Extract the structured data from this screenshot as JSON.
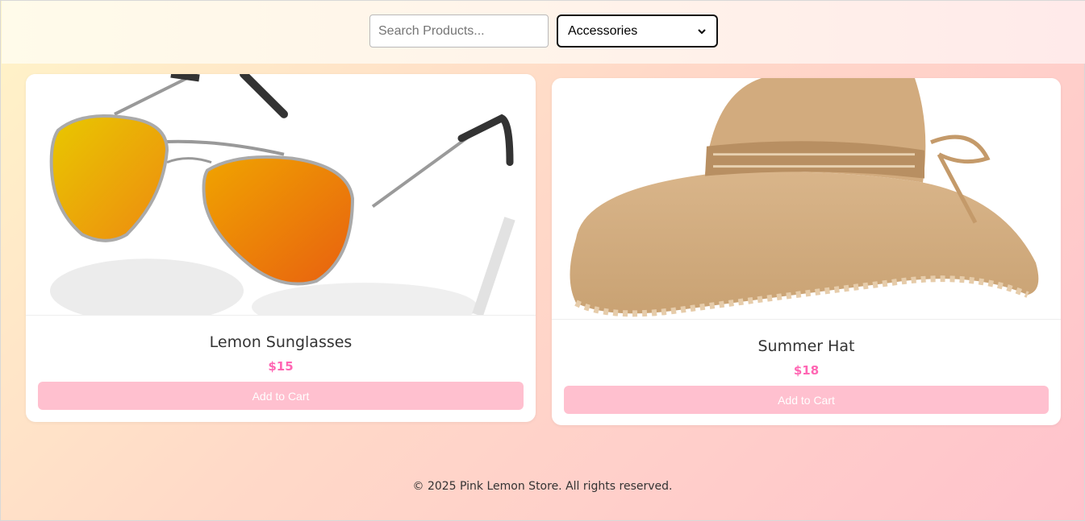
{
  "header": {
    "search_placeholder": "Search Products...",
    "category_selected": "Accessories"
  },
  "products": [
    {
      "name": "Lemon Sunglasses",
      "price": "$15",
      "button": "Add to Cart",
      "image": "sunglasses-image"
    },
    {
      "name": "Summer Hat",
      "price": "$18",
      "button": "Add to Cart",
      "image": "straw-hat-image"
    }
  ],
  "footer": {
    "text": "© 2025 Pink Lemon Store. All rights reserved."
  },
  "colors": {
    "accent_pink": "#ff66b3",
    "button_pink": "#ffc0cf"
  }
}
